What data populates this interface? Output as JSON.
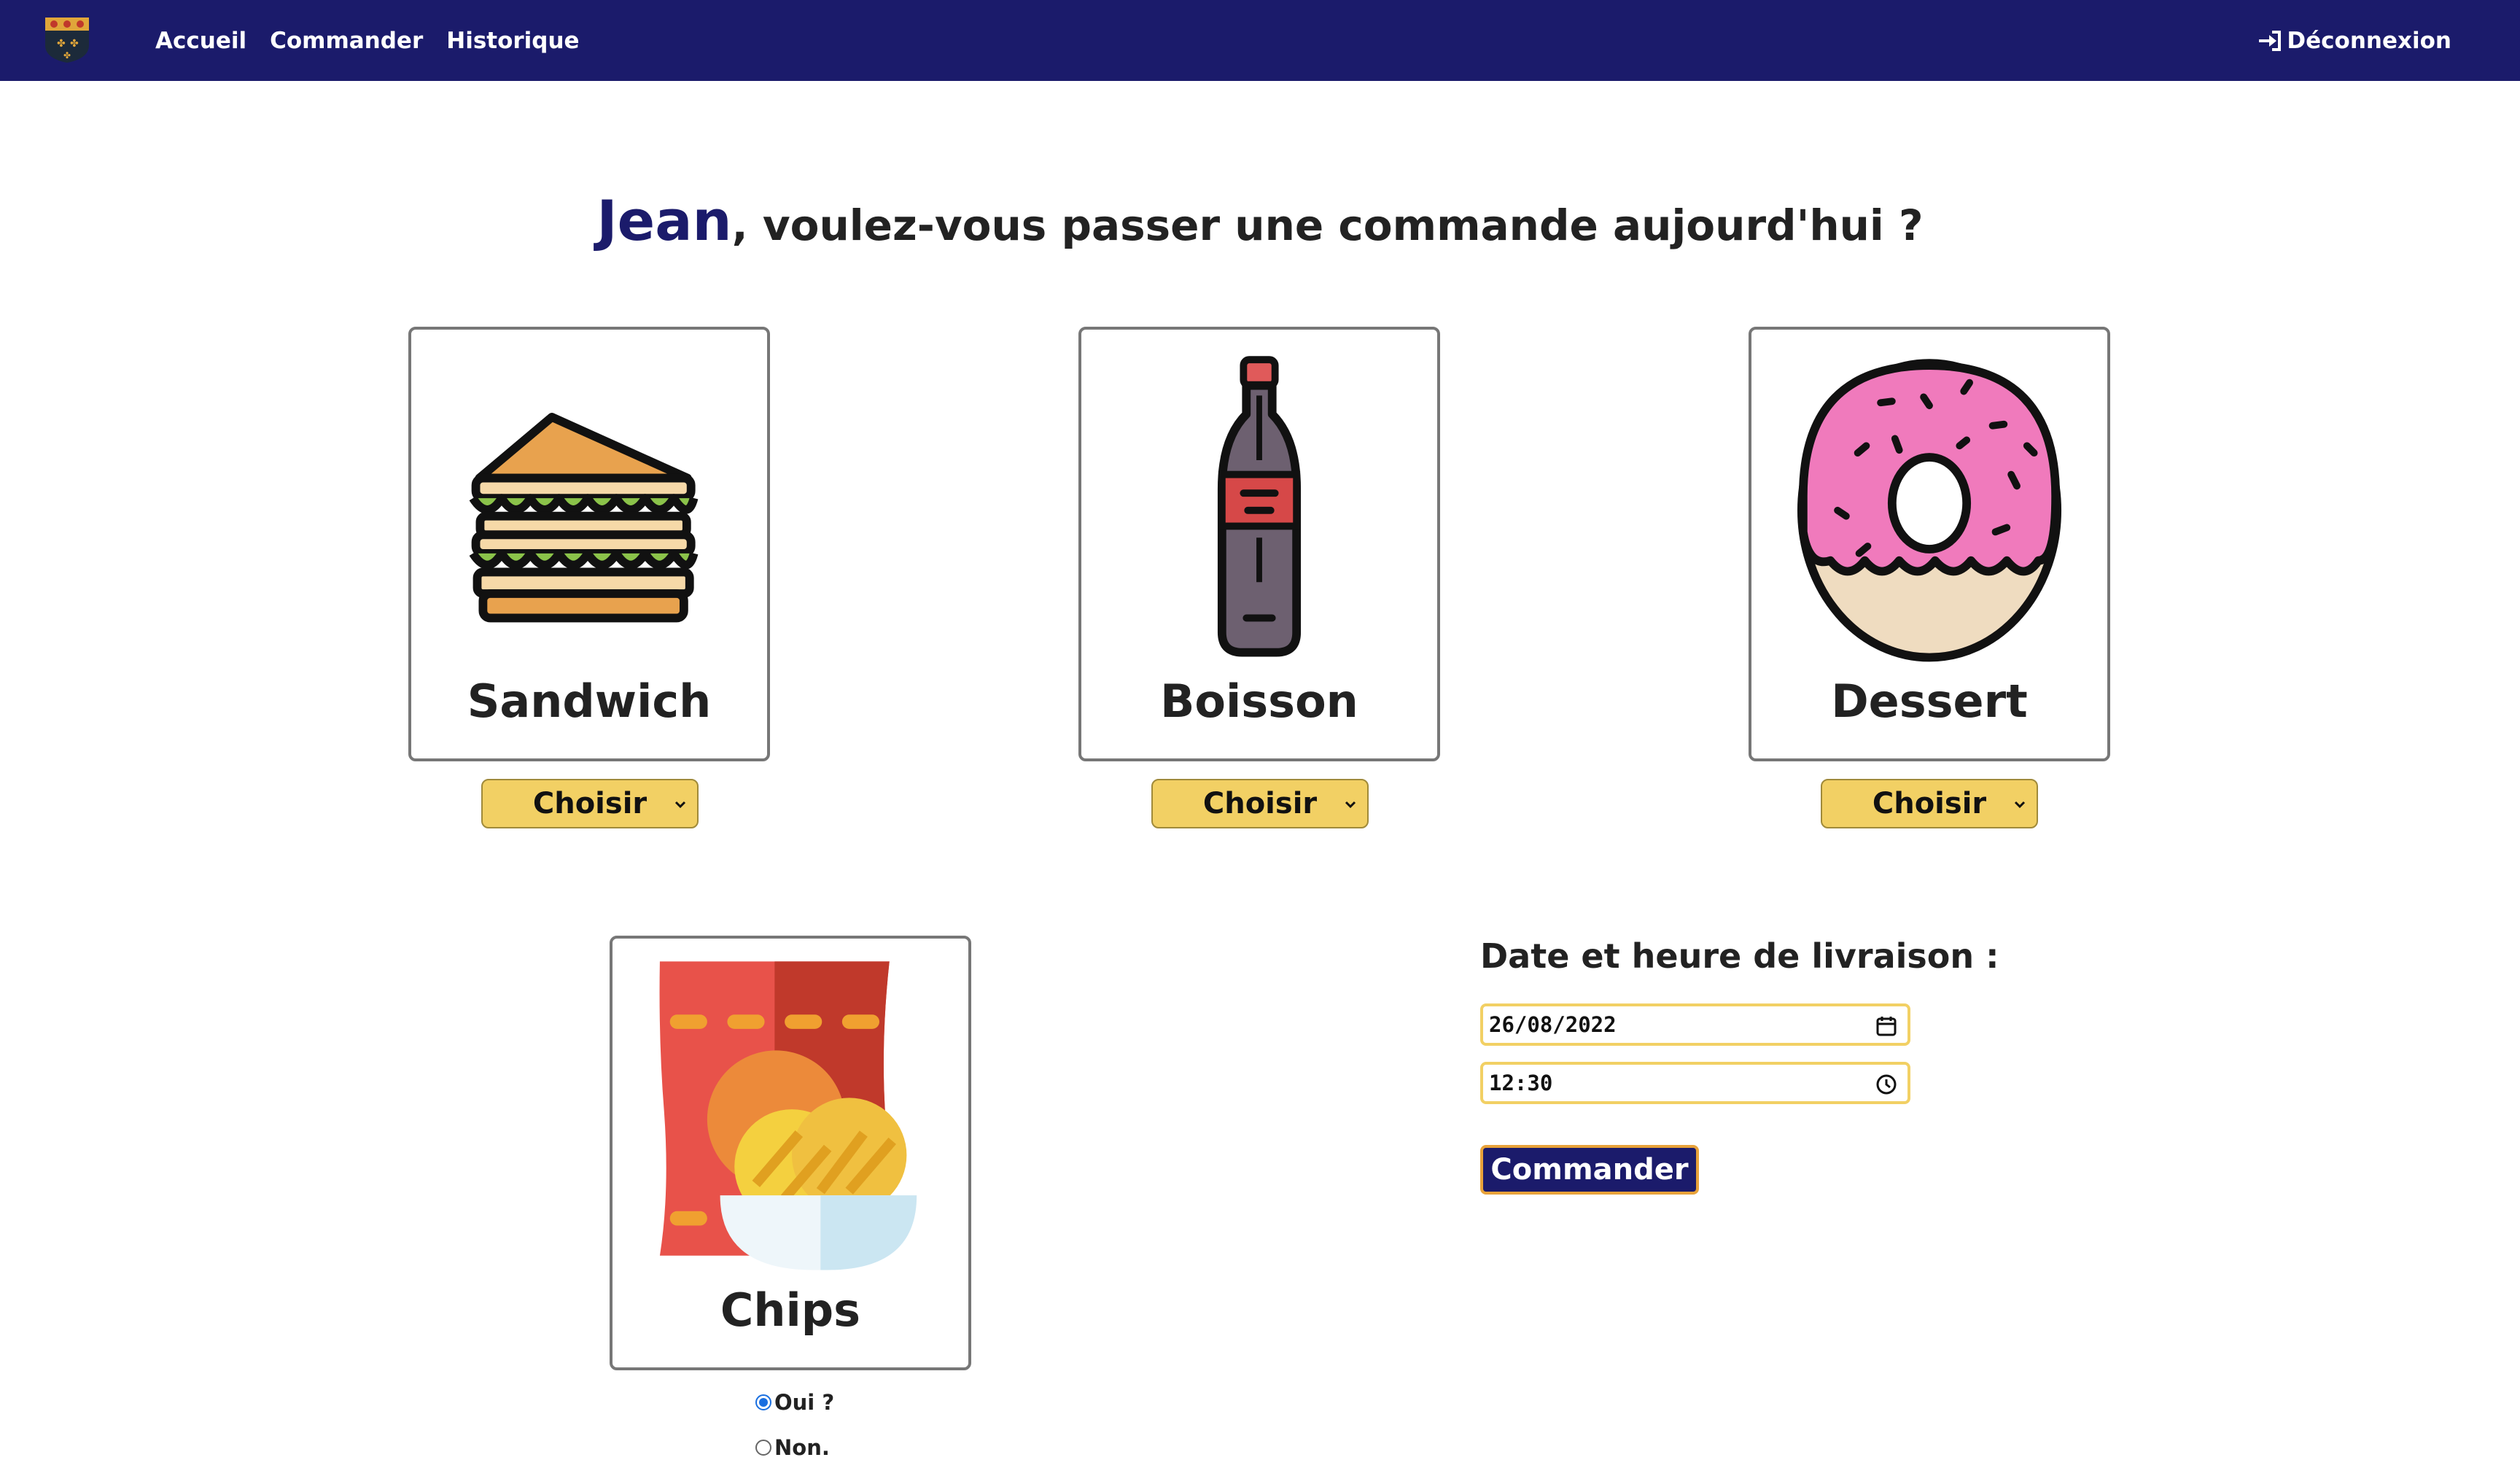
{
  "nav": {
    "links": [
      "Accueil",
      "Commander",
      "Historique"
    ],
    "logout_label": "Déconnexion"
  },
  "greeting": {
    "name": "Jean",
    "text": ", voulez-vous passer une commande aujourd'hui ?"
  },
  "cards": {
    "sandwich": {
      "label": "Sandwich",
      "select_value": "Choisir"
    },
    "boisson": {
      "label": "Boisson",
      "select_value": "Choisir"
    },
    "dessert": {
      "label": "Dessert",
      "select_value": "Choisir"
    },
    "chips": {
      "label": "Chips",
      "options": [
        {
          "label": "Oui ?",
          "checked": true
        },
        {
          "label": "Non.",
          "checked": false
        }
      ]
    }
  },
  "delivery": {
    "title": "Date et heure de livraison :",
    "date_value": "26/08/2022",
    "time_value": "12:30",
    "submit_label": "Commander"
  },
  "colors": {
    "navbar": "#1b1b6b",
    "select_bg": "#f2d064",
    "field_border": "#f2d064",
    "button_border": "#e8a23a"
  }
}
